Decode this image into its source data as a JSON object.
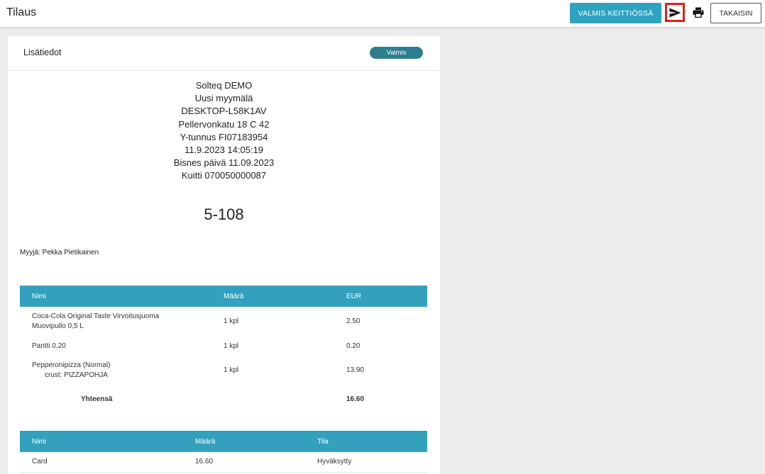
{
  "header": {
    "title": "Tilaus",
    "ready_kitchen_label": "VALMIS KEITTIÖSSÄ",
    "back_label": "TAKAISIN"
  },
  "card": {
    "title": "Lisätiedot",
    "status": "Valmis"
  },
  "receipt": {
    "lines": [
      "Solteq DEMO",
      "Uusi myymälä",
      "DESKTOP-L58K1AV",
      "Pellervonkatu 18 C 42",
      "Y-tunnus FI07183954",
      "11.9.2023 14:05:19",
      "Bisnes päivä 11.09.2023",
      "Kuitti 070050000087"
    ],
    "order_number": "5-108",
    "seller": "Myyjä: Pekka Pietikainen"
  },
  "items_table": {
    "headers": [
      "Nimi",
      "Määrä",
      "EUR"
    ],
    "rows": [
      {
        "name": "Coca-Cola Original Taste Virvoitusjuoma",
        "name2": "Muovipullo 0,5 L",
        "qty": "1 kpl",
        "eur": "2.50"
      },
      {
        "name": "Pantti 0,20",
        "qty": "1 kpl",
        "eur": "0.20"
      },
      {
        "name": "Pepperonipizza (Normal)",
        "name2": "crust: PIZZAPOHJA",
        "qty": "1 kpl",
        "eur": "13.90"
      }
    ],
    "total_label": "Yhteensä",
    "total_value": "16.60"
  },
  "payments_table": {
    "headers": [
      "Nimi",
      "Määrä",
      "Tila"
    ],
    "rows": [
      {
        "name": "Card",
        "amount": "16.60",
        "status": "Hyväksytty"
      }
    ]
  },
  "icons": {
    "send": "send-icon",
    "print": "printer-icon"
  },
  "colors": {
    "accent": "#2ea3bf",
    "status_pill": "#2f7d8f",
    "highlight_border": "#e02016"
  }
}
